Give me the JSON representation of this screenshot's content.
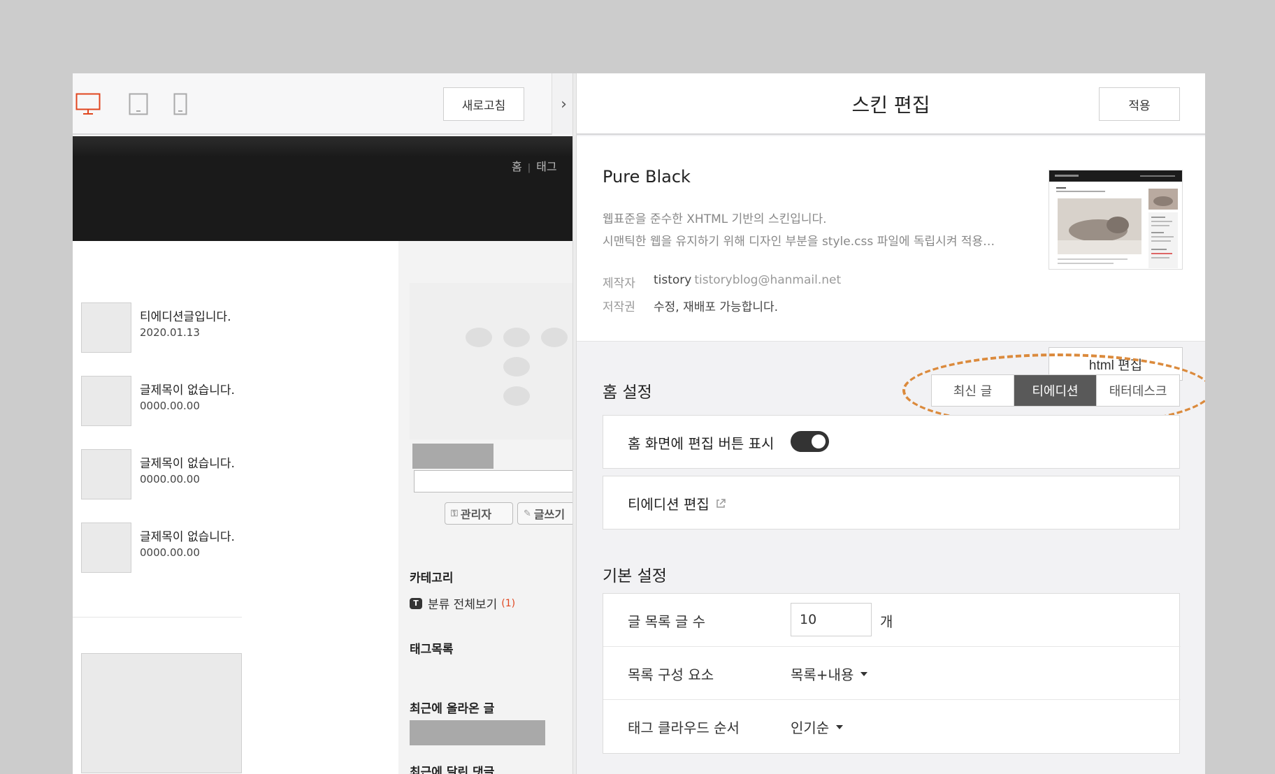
{
  "colors": {
    "accent_orange": "#db8a3c",
    "device_active": "#e0461f",
    "active_segment": "#595959"
  },
  "preview": {
    "device_icons": [
      "desktop-icon",
      "tablet-icon",
      "mobile-icon"
    ],
    "refresh_label": "새로고침",
    "collapse_icon": "chevron-right-icon",
    "collapse_glyph": "›",
    "blog_nav": [
      "홈",
      "태그"
    ],
    "posts": [
      {
        "title": "티에디션글입니다.",
        "date": "2020.01.13"
      },
      {
        "title": "글제목이 없습니다.",
        "date": "0000.00.00"
      },
      {
        "title": "글제목이 없습니다.",
        "date": "0000.00.00"
      },
      {
        "title": "글제목이 없습니다.",
        "date": "0000.00.00"
      }
    ],
    "sidebar": {
      "admin_button": "관리자",
      "write_button": "글쓰기",
      "category_heading": "카테고리",
      "category_all": "분류 전체보기",
      "category_count": "(1)",
      "tags_heading": "태그목록",
      "recent_posts_heading": "최근에 올라온 글",
      "recent_comments_heading": "최근에 달린 댓글"
    }
  },
  "editor": {
    "title": "스킨 편집",
    "apply_label": "적용",
    "skin": {
      "name": "Pure Black",
      "description_1": "웹표준을 준수한 XHTML 기반의 스킨입니다.",
      "description_2": "시맨틱한 웹을 유지하기 위해 디자인 부분을 style.css 파일에 독립시켜 적용…",
      "author_label": "제작자",
      "author_name": "tistory",
      "author_email": "tistoryblog@hanmail.net",
      "copyright_label": "저작권",
      "copyright_value": "수정, 재배포 가능합니다.",
      "html_edit_label": "html 편집"
    },
    "home_settings": {
      "heading": "홈 설정",
      "options": [
        "최신 글",
        "티에디션",
        "태터데스크"
      ],
      "selected": "티에디션",
      "show_edit_button_label": "홈 화면에 편집 버튼 표시",
      "show_edit_button_on": true,
      "tedition_edit_label": "티에디션 편집"
    },
    "basic_settings": {
      "heading": "기본 설정",
      "posts_per_page_label": "글 목록 글 수",
      "posts_per_page_value": "10",
      "posts_per_page_unit": "개",
      "list_components_label": "목록 구성 요소",
      "list_components_value": "목록+내용",
      "tag_cloud_order_label": "태그 클라우드 순서",
      "tag_cloud_order_value": "인기순"
    }
  }
}
